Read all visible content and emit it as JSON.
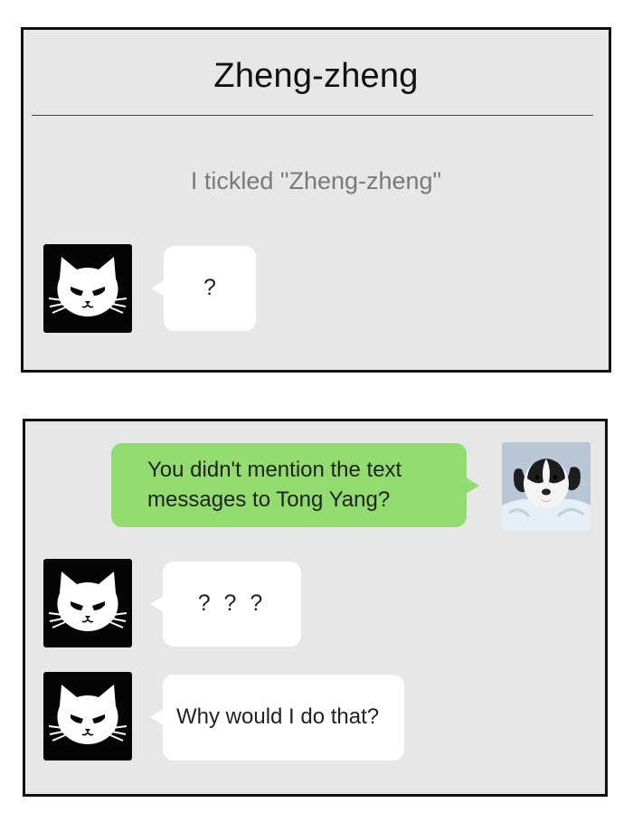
{
  "chat_header": {
    "title": "Zheng-zheng"
  },
  "system_notice": "I tickled \"Zheng-zheng\"",
  "panel1_messages": [
    {
      "sender": "cat",
      "avatar_icon": "cat-icon",
      "text": "?"
    }
  ],
  "panel2_messages": [
    {
      "sender": "dog",
      "avatar_icon": "dog-avatar",
      "text": "You didn't mention the text messages to Tong Yang?"
    },
    {
      "sender": "cat",
      "avatar_icon": "cat-icon",
      "text": "? ? ?"
    },
    {
      "sender": "cat",
      "avatar_icon": "cat-icon",
      "text": "Why would I do that?"
    }
  ],
  "colors": {
    "panel_background": "#e7e7e7",
    "incoming_bubble": "#ffffff",
    "outgoing_bubble": "#92dc70",
    "cat_avatar_background": "#050505"
  }
}
